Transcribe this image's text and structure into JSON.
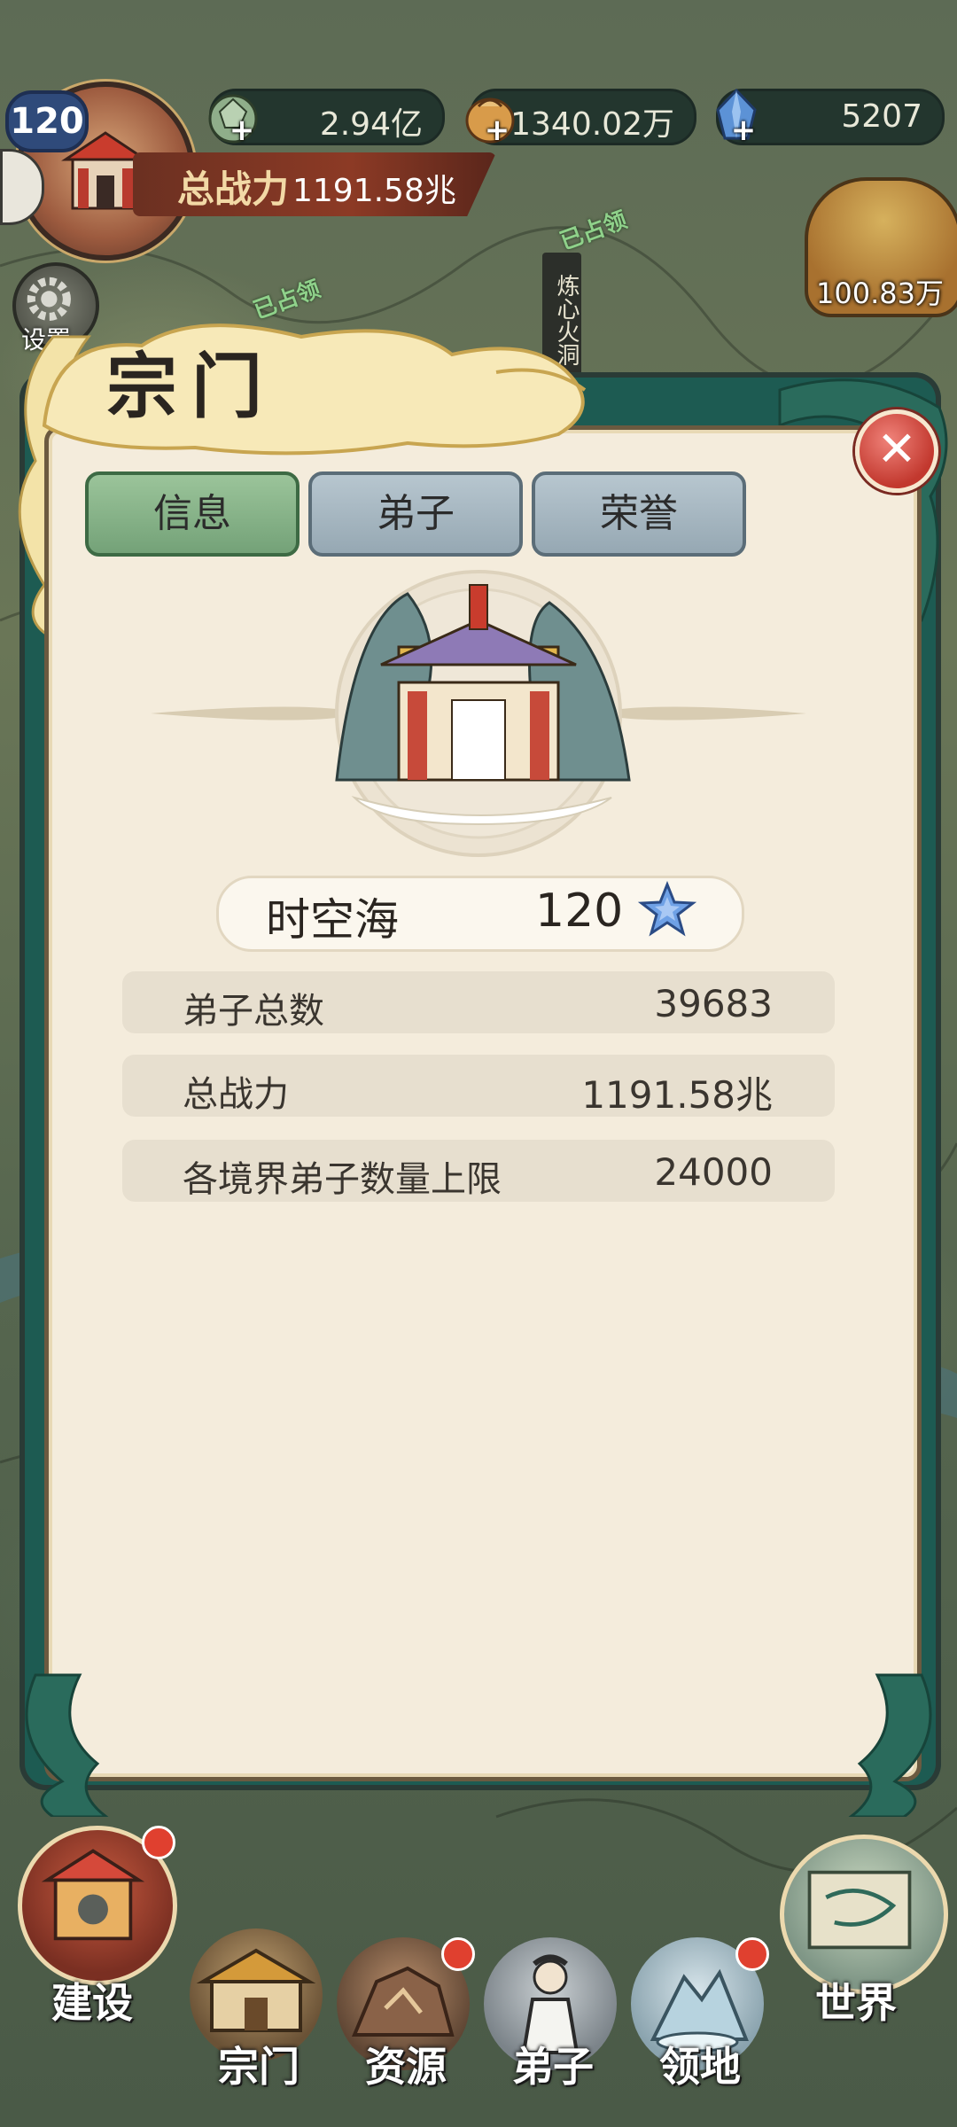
{
  "hud": {
    "level": "120",
    "power_label": "总战力",
    "power_value": "1191.58兆",
    "resources": [
      {
        "name": "jade",
        "value": "2.94亿",
        "icon": "jade-ore-icon"
      },
      {
        "name": "grain",
        "value": "1340.02万",
        "icon": "grain-sack-icon"
      },
      {
        "name": "crystal",
        "value": "5207",
        "icon": "blue-crystal-icon"
      }
    ],
    "plus": "+",
    "settings_label": "设置",
    "bag_value": "100.83万",
    "map_location": "炼心火洞",
    "occupied_label": "已占领"
  },
  "modal": {
    "title": "宗门",
    "close_symbol": "✕",
    "tabs": [
      {
        "label": "信息",
        "active": true
      },
      {
        "label": "弟子",
        "active": false
      },
      {
        "label": "荣誉",
        "active": false
      }
    ],
    "sect_name": "时空海",
    "sect_level": "120",
    "stats": [
      {
        "label": "弟子总数",
        "value": "39683"
      },
      {
        "label": "总战力",
        "value": "1191.58兆"
      },
      {
        "label": "各境界弟子数量上限",
        "value": "24000"
      }
    ]
  },
  "bottom_nav": {
    "build": "建设",
    "world": "世界",
    "items": [
      {
        "label": "宗门",
        "badge": false
      },
      {
        "label": "资源",
        "badge": true
      },
      {
        "label": "弟子",
        "badge": false
      },
      {
        "label": "领地",
        "badge": true
      }
    ]
  },
  "colors": {
    "panel_bg": "#f4ecdc",
    "tab_active": "#8fb98e",
    "tab_inactive": "#a8b9c3",
    "close_red": "#d5483d",
    "frame_green": "#1d5b52"
  }
}
